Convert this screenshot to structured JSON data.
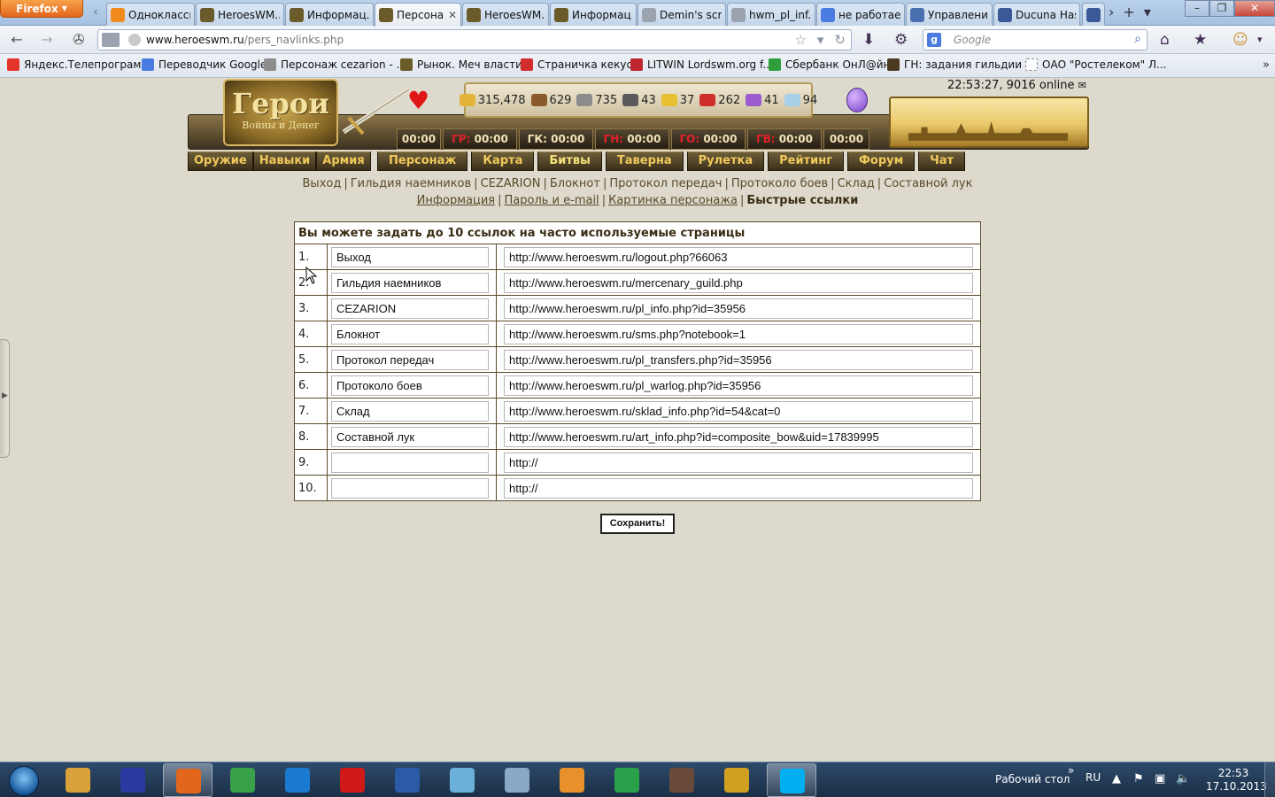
{
  "browser": {
    "app_button": "Firefox",
    "tabs": [
      {
        "label": "Одноклассн...",
        "icon_color": "#f08a1c",
        "icon": "ok-icon",
        "active": false
      },
      {
        "label": "HeroesWM....",
        "icon_color": "#6b5a2a",
        "icon": "hwm-icon",
        "active": false
      },
      {
        "label": "Информац...",
        "icon_color": "#6b5a2a",
        "icon": "hwm-icon",
        "active": false
      },
      {
        "label": "Персона...",
        "icon_color": "#6b5a2a",
        "icon": "hwm-icon",
        "active": true
      },
      {
        "label": "HeroesWM....",
        "icon_color": "#6b5a2a",
        "icon": "hwm-icon",
        "active": false
      },
      {
        "label": "Информац...",
        "icon_color": "#6b5a2a",
        "icon": "hwm-icon",
        "active": false
      },
      {
        "label": "Demin's scri...",
        "icon_color": "#9aa3ae",
        "icon": "script-icon",
        "active": false
      },
      {
        "label": "hwm_pl_inf...",
        "icon_color": "#9aa3ae",
        "icon": "script-icon",
        "active": false
      },
      {
        "label": "не работае...",
        "icon_color": "#4a7be0",
        "icon": "google-icon",
        "active": false
      },
      {
        "label": "Управлени...",
        "icon_color": "#4a6fb0",
        "icon": "puzzle-icon",
        "active": false
      },
      {
        "label": "Ducuna Hash",
        "icon_color": "#3b5998",
        "icon": "facebook-icon",
        "active": false
      },
      {
        "label": "F",
        "icon_color": "#3b5998",
        "icon": "facebook-icon",
        "active": false
      }
    ],
    "url_host": "www.heroeswm.ru",
    "url_path": "/pers_navlinks.php",
    "search_placeholder": "Google",
    "bookmarks": [
      {
        "label": "Яндекс.Телепрограм...",
        "icon_color": "#e5352b"
      },
      {
        "label": "Переводчик Google",
        "icon_color": "#4a7be0"
      },
      {
        "label": "Персонаж cezarion - ...",
        "icon_color": "#8d8d8d"
      },
      {
        "label": "Рынок. Меч власти.",
        "icon_color": "#6b5a2a"
      },
      {
        "label": "Страничка кекуса",
        "icon_color": "#d22e2e"
      },
      {
        "label": "LITWIN Lordswm.org f...",
        "icon_color": "#c0262e"
      },
      {
        "label": "Сбербанк ОнЛ@йн",
        "icon_color": "#2e9e3a"
      },
      {
        "label": "ГН: задания гильдии ...",
        "icon_color": "#4a3a20"
      },
      {
        "label": "ОАО \"Ростелеком\" Л...",
        "icon_color": "#ffffff"
      }
    ]
  },
  "game": {
    "logo_title": "Герои",
    "logo_subtitle": "Войны и Денег",
    "online_text": "22:53:27, 9016 online",
    "resources": [
      {
        "value": "315,478",
        "color": "#e2b53a",
        "icon": "gold-icon"
      },
      {
        "value": "629",
        "color": "#8a5a2a",
        "icon": "wood-icon"
      },
      {
        "value": "735",
        "color": "#8c8c8c",
        "icon": "ore-icon"
      },
      {
        "value": "43",
        "color": "#5a5a5a",
        "icon": "mercury-icon"
      },
      {
        "value": "37",
        "color": "#e6c030",
        "icon": "sulfur-icon"
      },
      {
        "value": "262",
        "color": "#d0302a",
        "icon": "crystal-icon"
      },
      {
        "value": "41",
        "color": "#9a5ad0",
        "icon": "gems-icon"
      },
      {
        "value": "94",
        "color": "#a8d0e8",
        "icon": "diamond-icon"
      }
    ],
    "timers": [
      {
        "label": "",
        "value": "00:00",
        "red": false,
        "w": 50
      },
      {
        "label": "ГР:",
        "value": "00:00",
        "red": true,
        "w": 84
      },
      {
        "label": "ГК:",
        "value": "00:00",
        "red": false,
        "w": 84
      },
      {
        "label": "ГН:",
        "value": "00:00",
        "red": true,
        "w": 84
      },
      {
        "label": "ГО:",
        "value": "00:00",
        "red": true,
        "w": 84
      },
      {
        "label": "ГВ:",
        "value": "00:00",
        "red": true,
        "w": 84
      },
      {
        "label": "",
        "value": "00:00",
        "red": false,
        "w": 52
      }
    ],
    "menu_left": [
      "Оружие",
      "Навыки",
      "Армия"
    ],
    "menu_right": [
      {
        "label": "Персонаж",
        "highlight": false
      },
      {
        "label": "Карта",
        "highlight": false
      },
      {
        "label": "Битвы",
        "highlight": true
      },
      {
        "label": "Таверна",
        "highlight": false
      },
      {
        "label": "Рулетка",
        "highlight": false
      },
      {
        "label": "Рейтинг",
        "highlight": false
      },
      {
        "label": "Форум",
        "highlight": false
      },
      {
        "label": "Чат",
        "highlight": false
      }
    ],
    "quick_links": [
      "Выход",
      "Гильдия наемников",
      "CEZARION",
      "Блокнот",
      "Протокол передач",
      "Протоколо боев",
      "Склад",
      "Составной лук"
    ],
    "sub_nav": [
      {
        "label": "Информация",
        "current": false
      },
      {
        "label": "Пароль и e-mail",
        "current": false
      },
      {
        "label": "Картинка персонажа",
        "current": false
      },
      {
        "label": "Быстрые ссылки",
        "current": true
      }
    ]
  },
  "links_form": {
    "header": "Вы можете задать до 10 ссылок на часто используемые страницы",
    "rows": [
      {
        "num": "1.",
        "name": "Выход",
        "url": "http://www.heroeswm.ru/logout.php?66063"
      },
      {
        "num": "2.",
        "name": "Гильдия наемников",
        "url": "http://www.heroeswm.ru/mercenary_guild.php"
      },
      {
        "num": "3.",
        "name": "CEZARION",
        "url": "http://www.heroeswm.ru/pl_info.php?id=35956"
      },
      {
        "num": "4.",
        "name": "Блокнот",
        "url": "http://www.heroeswm.ru/sms.php?notebook=1"
      },
      {
        "num": "5.",
        "name": "Протокол передач",
        "url": "http://www.heroeswm.ru/pl_transfers.php?id=35956"
      },
      {
        "num": "6.",
        "name": "Протоколо боев",
        "url": "http://www.heroeswm.ru/pl_warlog.php?id=35956"
      },
      {
        "num": "7.",
        "name": "Склад",
        "url": "http://www.heroeswm.ru/sklad_info.php?id=54&cat=0"
      },
      {
        "num": "8.",
        "name": "Составной лук",
        "url": "http://www.heroeswm.ru/art_info.php?id=composite_bow&uid=17839995"
      },
      {
        "num": "9.",
        "name": "",
        "url": "http://"
      },
      {
        "num": "10.",
        "name": "",
        "url": "http://"
      }
    ],
    "save_label": "Сохранить!"
  },
  "taskbar": {
    "apps": [
      {
        "name": "explorer",
        "color": "#d9a23a",
        "icon": "folder-icon"
      },
      {
        "name": "floppy",
        "color": "#2a3aa0",
        "icon": "save-icon"
      },
      {
        "name": "firefox",
        "color": "#e2661b",
        "icon": "firefox-icon",
        "active": true
      },
      {
        "name": "chrome",
        "color": "#3aa04a",
        "icon": "chrome-icon"
      },
      {
        "name": "maxthon",
        "color": "#1a7ad0",
        "icon": "maxthon-icon"
      },
      {
        "name": "opera",
        "color": "#d01a1a",
        "icon": "opera-icon"
      },
      {
        "name": "word",
        "color": "#2a5aa8",
        "icon": "word-icon"
      },
      {
        "name": "notepad",
        "color": "#6ab0d8",
        "icon": "notepad-icon"
      },
      {
        "name": "calculator",
        "color": "#8aa8c8",
        "icon": "calculator-icon"
      },
      {
        "name": "media",
        "color": "#e8902a",
        "icon": "media-icon"
      },
      {
        "name": "book",
        "color": "#2aa04a",
        "icon": "book-icon"
      },
      {
        "name": "game",
        "color": "#6a4a3a",
        "icon": "game-icon"
      },
      {
        "name": "chess",
        "color": "#d0a020",
        "icon": "chess-icon"
      },
      {
        "name": "skype",
        "color": "#00aff0",
        "icon": "skype-icon",
        "active": true
      }
    ],
    "desktop_label": "Рабочий стол",
    "lang": "RU",
    "time": "22:53",
    "date": "17.10.2013"
  }
}
